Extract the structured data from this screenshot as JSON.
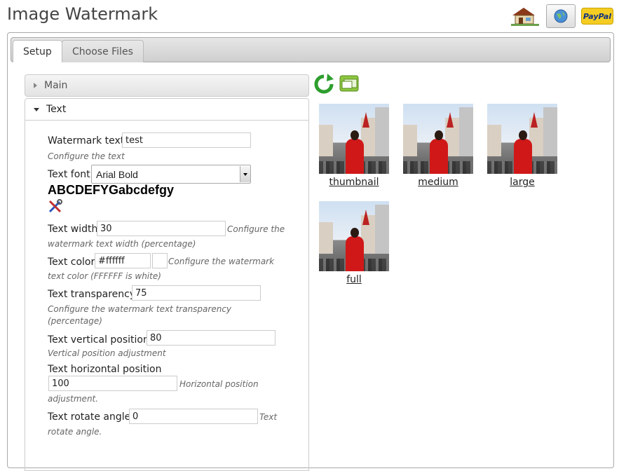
{
  "app_title": "Image Watermark",
  "header_icons": {
    "home_icon": "house-icon",
    "globe_icon": "globe-icon",
    "paypal_label": "PayPal"
  },
  "tabs": [
    {
      "label": "Setup",
      "active": true
    },
    {
      "label": "Choose Files",
      "active": false
    }
  ],
  "accordion": {
    "main_label": "Main",
    "text_label": "Text"
  },
  "form": {
    "watermark_text_label": "Watermark text",
    "watermark_text_value": "test",
    "watermark_text_hint": "Configure the text",
    "text_font_label": "Text font",
    "text_font_value": "Arial Bold",
    "font_preview": "ABCDEFYGabcdefgy",
    "text_width_label": "Text width",
    "text_width_value": "30",
    "text_width_hint_1": "Configure the",
    "text_width_hint_2": "watermark text width (percentage)",
    "text_color_label": "Text color",
    "text_color_value": "#ffffff",
    "text_color_hint_1": "Configure the watermark",
    "text_color_hint_2": "text color (FFFFFF is white)",
    "text_transparency_label": "Text transparency",
    "text_transparency_value": "75",
    "text_transparency_hint_1": "Configure the watermark text transparency",
    "text_transparency_hint_2": "(percentage)",
    "vertical_position_label": "Text vertical position",
    "vertical_position_value": "80",
    "vertical_position_hint": "Vertical position adjustment",
    "horizontal_position_label": "Text horizontal position",
    "horizontal_position_value": "100",
    "horizontal_position_hint_1": "Horizontal position",
    "horizontal_position_hint_2": "adjustment.",
    "rotate_angle_label": "Text rotate angle",
    "rotate_angle_value": "0",
    "rotate_angle_hint_1": "Text",
    "rotate_angle_hint_2": "rotate angle."
  },
  "toolbar_icons": [
    "refresh-icon",
    "preview-icon"
  ],
  "previews": [
    {
      "label": "thumbnail"
    },
    {
      "label": "medium"
    },
    {
      "label": "large"
    },
    {
      "label": "full"
    }
  ],
  "colors": {
    "accent_green": "#2e9e2e",
    "link_text": "#222222"
  }
}
